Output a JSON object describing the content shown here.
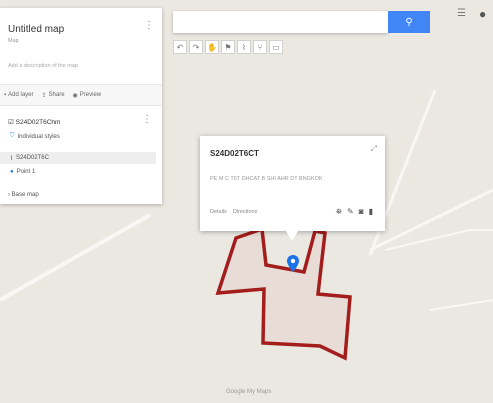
{
  "panel": {
    "title": "Untitled map",
    "subtitle": "Map",
    "description": "Add a description of the map",
    "actions": [
      {
        "icon": "add-layer-icon",
        "label": "Add layer"
      },
      {
        "icon": "share-icon",
        "label": "Share"
      },
      {
        "icon": "preview-icon",
        "label": "Preview"
      }
    ],
    "layer": {
      "name": "S24D02T6Chm",
      "items": [
        {
          "icon": "style-icon",
          "label": "Individual styles"
        },
        {
          "icon": "line-icon",
          "label": "S24D02T6C"
        },
        {
          "icon": "pin-icon",
          "label": "Point 1"
        }
      ]
    },
    "basemap": "Base map"
  },
  "search": {
    "placeholder": "",
    "button_icon": "search-icon"
  },
  "toolbar": [
    "undo-icon",
    "redo-icon",
    "hand-icon",
    "marker-icon",
    "draw-line-icon",
    "directions-icon",
    "ruler-icon"
  ],
  "popup": {
    "title": "S24D02T6CT",
    "address": "PE M C T6T DHCAT B SHI AHR DT BNGKOK",
    "footer": [
      "Details",
      "Directions"
    ],
    "icons": [
      "paint-icon",
      "edit-icon",
      "camera-icon",
      "delete-icon"
    ]
  },
  "colors": {
    "accent": "#4285f4",
    "polygon": "#a31d1d",
    "marker": "#1a73e8"
  },
  "footer": "Google My Maps"
}
